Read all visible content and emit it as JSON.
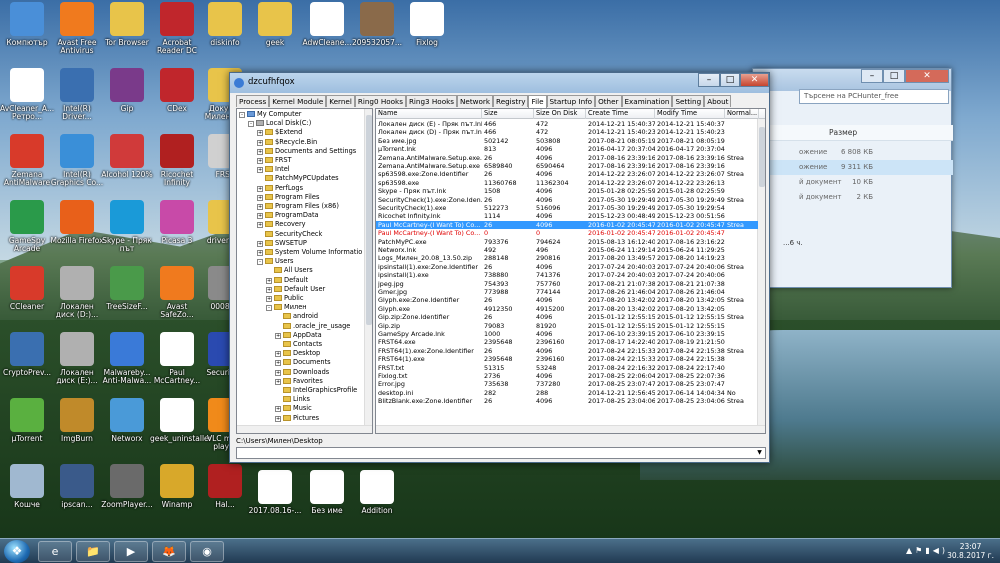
{
  "desktop": {
    "icons": [
      {
        "label": "Компютър",
        "color": "#4a8fd8"
      },
      {
        "label": "Avast Free Antivirus",
        "color": "#f07a1e"
      },
      {
        "label": "Tor Browser",
        "color": "#e8c44a"
      },
      {
        "label": "Acrobat Reader DC",
        "color": "#c0262c"
      },
      {
        "label": "diskinfo",
        "color": "#e8c44a"
      },
      {
        "label": "geek",
        "color": "#e8c44a"
      },
      {
        "label": "AdwCleane...",
        "color": "#ffffff"
      },
      {
        "label": "209532057...",
        "color": "#8a6a4a"
      },
      {
        "label": "Fixlog",
        "color": "#ffffff"
      },
      {
        "label": "AvCleaner_А... Ретро...",
        "color": "#ffffff"
      },
      {
        "label": "Intel(R) Driver...",
        "color": "#3a6fb0"
      },
      {
        "label": "Gip",
        "color": "#7a3a8a"
      },
      {
        "label": "CDex",
        "color": "#c0262c"
      },
      {
        "label": "Докум... Милен К...",
        "color": "#e8c44a"
      },
      {
        "label": "Zemana AntiMalware",
        "color": "#d83a2a"
      },
      {
        "label": "Intel(R) Graphics Co...",
        "color": "#3a8fd8"
      },
      {
        "label": "Alcohol 120%",
        "color": "#d03a3a"
      },
      {
        "label": "Ricochet Infinity",
        "color": "#b02020"
      },
      {
        "label": "FRST",
        "color": "#d0d0d0"
      },
      {
        "label": "GameSpy Arcade",
        "color": "#2a9a4a"
      },
      {
        "label": "Mozilla Firefox",
        "color": "#e8601a"
      },
      {
        "label": "Skype - Пряк път",
        "color": "#1a9ad8"
      },
      {
        "label": "Picasa 3",
        "color": "#c84aa8"
      },
      {
        "label": "driver a...",
        "color": "#e8c44a"
      },
      {
        "label": "CCleaner",
        "color": "#d83a2a"
      },
      {
        "label": "Локален диск (D:)...",
        "color": "#b0b0b0"
      },
      {
        "label": "TreeSizeF...",
        "color": "#4a9a4a"
      },
      {
        "label": "Avast SafeZo...",
        "color": "#f07a1e"
      },
      {
        "label": "0008-...",
        "color": "#8a8a8a"
      },
      {
        "label": "CryptoPrev...",
        "color": "#3a6fb0"
      },
      {
        "label": "Локален диск (E:)...",
        "color": "#b0b0b0"
      },
      {
        "label": "Malwareby... Anti-Malwa...",
        "color": "#3a7ad8"
      },
      {
        "label": "Paul McCartney...",
        "color": "#ffffff"
      },
      {
        "label": "Security...",
        "color": "#2a4ab0"
      },
      {
        "label": "µTorrent",
        "color": "#5ab040"
      },
      {
        "label": "ImgBurn",
        "color": "#c08a2a"
      },
      {
        "label": "Networx",
        "color": "#4a9ad8"
      },
      {
        "label": "geek_uninstaller",
        "color": "#ffffff"
      },
      {
        "label": "VLC me... player",
        "color": "#f08a1a"
      },
      {
        "label": "Кошче",
        "color": "#a0b8d0"
      },
      {
        "label": "ipscan...",
        "color": "#3a5a8a"
      },
      {
        "label": "ZoomPlayer...",
        "color": "#6a6a6a"
      },
      {
        "label": "Winamp",
        "color": "#d8a82a"
      },
      {
        "label": "Hal...",
        "color": "#b02020"
      },
      {
        "label": "2017.08.16-...",
        "color": "#ffffff"
      },
      {
        "label": "Без име",
        "color": "#ffffff"
      },
      {
        "label": "Addition",
        "color": "#ffffff"
      }
    ]
  },
  "explorer": {
    "search_placeholder": "Търсене на PCHunter_free",
    "size_header": "Размер",
    "rows": [
      {
        "name": "ожение",
        "size": "6 808 КБ"
      },
      {
        "name": "ожение",
        "size": "9 311 КБ"
      },
      {
        "name": "й документ",
        "size": "10 КБ"
      },
      {
        "name": "й документ",
        "size": "2 КБ"
      }
    ],
    "footer": "...6 ч."
  },
  "window": {
    "title": "dzcufhfqox",
    "tabs": [
      "Process",
      "Kernel Module",
      "Kernel",
      "Ring0 Hooks",
      "Ring3 Hooks",
      "Network",
      "Registry",
      "File",
      "Startup Info",
      "Other",
      "Examination",
      "Setting",
      "About"
    ],
    "active_tab": "File",
    "tree": [
      {
        "label": "My Computer",
        "level": 0,
        "box": "-"
      },
      {
        "label": "Local Disk(C:)",
        "level": 1,
        "box": "-"
      },
      {
        "label": "$Extend",
        "level": 2,
        "box": "+"
      },
      {
        "label": "$Recycle.Bin",
        "level": 2,
        "box": "+"
      },
      {
        "label": "Documents and Settings",
        "level": 2,
        "box": "+"
      },
      {
        "label": "FRST",
        "level": 2,
        "box": "+"
      },
      {
        "label": "Intel",
        "level": 2,
        "box": "+"
      },
      {
        "label": "PatchMyPCUpdates",
        "level": 2,
        "box": ""
      },
      {
        "label": "PerfLogs",
        "level": 2,
        "box": "+"
      },
      {
        "label": "Program Files",
        "level": 2,
        "box": "+"
      },
      {
        "label": "Program Files (x86)",
        "level": 2,
        "box": "+"
      },
      {
        "label": "ProgramData",
        "level": 2,
        "box": "+"
      },
      {
        "label": "Recovery",
        "level": 2,
        "box": "+"
      },
      {
        "label": "SecurityCheck",
        "level": 2,
        "box": ""
      },
      {
        "label": "SWSETUP",
        "level": 2,
        "box": "+"
      },
      {
        "label": "System Volume Informatio",
        "level": 2,
        "box": "+"
      },
      {
        "label": "Users",
        "level": 2,
        "box": "-"
      },
      {
        "label": "All Users",
        "level": 3,
        "box": ""
      },
      {
        "label": "Default",
        "level": 3,
        "box": "+"
      },
      {
        "label": "Default User",
        "level": 3,
        "box": "+"
      },
      {
        "label": "Public",
        "level": 3,
        "box": "+"
      },
      {
        "label": "Милен",
        "level": 3,
        "box": "-"
      },
      {
        "label": "android",
        "level": 4,
        "box": ""
      },
      {
        "label": ".oracle_jre_usage",
        "level": 4,
        "box": ""
      },
      {
        "label": "AppData",
        "level": 4,
        "box": "+"
      },
      {
        "label": "Contacts",
        "level": 4,
        "box": ""
      },
      {
        "label": "Desktop",
        "level": 4,
        "box": "+"
      },
      {
        "label": "Documents",
        "level": 4,
        "box": "+"
      },
      {
        "label": "Downloads",
        "level": 4,
        "box": "+"
      },
      {
        "label": "Favorites",
        "level": 4,
        "box": "+"
      },
      {
        "label": "IntelGraphicsProfile",
        "level": 4,
        "box": ""
      },
      {
        "label": "Links",
        "level": 4,
        "box": ""
      },
      {
        "label": "Music",
        "level": 4,
        "box": "+"
      },
      {
        "label": "Pictures",
        "level": 4,
        "box": "+"
      }
    ],
    "columns": [
      "Name",
      "Size",
      "Size On Disk",
      "Create Time",
      "Modify Time",
      "Normal..."
    ],
    "files": [
      [
        "Локален диск (E) - Пряк път.lnk",
        "466",
        "472",
        "2014-12-21 15:40:37",
        "2014-12-21 15:40:37",
        ""
      ],
      [
        "Локален диск (D) - Пряк път.lnk",
        "466",
        "472",
        "2014-12-21 15:40:23",
        "2014-12-21 15:40:23",
        ""
      ],
      [
        "Без име.jpg",
        "502142",
        "503808",
        "2017-08-21 08:05:19",
        "2017-08-21 08:05:19",
        ""
      ],
      [
        "µTorrent.lnk",
        "813",
        "4096",
        "2016-04-17 20:37:04",
        "2016-04-17 20:37:04",
        ""
      ],
      [
        "Zemana.AntiMalware.Setup.exe...",
        "26",
        "4096",
        "2017-08-16 23:39:16",
        "2017-08-16 23:39:16",
        "Strea"
      ],
      [
        "Zemana.AntiMalware.Setup.exe",
        "6589840",
        "6590464",
        "2017-08-16 23:39:16",
        "2017-08-16 23:39:16",
        ""
      ],
      [
        "sp63598.exe:Zone.Identifier",
        "26",
        "4096",
        "2014-12-22 23:26:07",
        "2014-12-22 23:26:07",
        "Strea"
      ],
      [
        "sp63598.exe",
        "11360768",
        "11362304",
        "2014-12-22 23:26:07",
        "2014-12-22 23:26:13",
        ""
      ],
      [
        "Skype - Пряк път.lnk",
        "1508",
        "4096",
        "2015-01-28 02:25:59",
        "2015-01-28 02:25:59",
        ""
      ],
      [
        "SecurityCheck(1).exe:Zone.Iden...",
        "26",
        "4096",
        "2017-05-30 19:29:49",
        "2017-05-30 19:29:49",
        "Strea"
      ],
      [
        "SecurityCheck(1).exe",
        "512273",
        "516096",
        "2017-05-30 19:29:49",
        "2017-05-30 19:29:54",
        ""
      ],
      [
        "Ricochet Infinity.lnk",
        "1114",
        "4096",
        "2015-12-23 00:48:49",
        "2015-12-23 00:51:56",
        ""
      ],
      [
        "Paul McCartney-(I Want To) Co...",
        "26",
        "4096",
        "2016-01-02 20:45:47",
        "2016-01-02 20:45:47",
        "Strea"
      ],
      [
        "Paul McCartney-(I Want To) Co...",
        "0",
        "0",
        "2016-01-02 20:45:47",
        "2016-01-02 20:45:47",
        ""
      ],
      [
        "PatchMyPC.exe",
        "793376",
        "794624",
        "2015-08-13 16:12:40",
        "2017-08-16 23:16:22",
        ""
      ],
      [
        "Networx.lnk",
        "492",
        "496",
        "2015-06-24 11:29:14",
        "2015-06-24 11:29:25",
        ""
      ],
      [
        "Logs_Милен_20.08_13.50.zip",
        "288148",
        "290816",
        "2017-08-20 13:49:57",
        "2017-08-20 14:19:23",
        ""
      ],
      [
        "ipsinstall(1).exe:Zone.Identifier",
        "26",
        "4096",
        "2017-07-24 20:40:03",
        "2017-07-24 20:40:06",
        "Strea"
      ],
      [
        "ipsinstall(1).exe",
        "738880",
        "741376",
        "2017-07-24 20:40:03",
        "2017-07-24 20:40:06",
        ""
      ],
      [
        "jpeg.jpg",
        "754393",
        "757760",
        "2017-08-21 21:07:38",
        "2017-08-21 21:07:38",
        ""
      ],
      [
        "Gmer.jpg",
        "773988",
        "774144",
        "2017-08-26 21:46:04",
        "2017-08-26 21:46:04",
        ""
      ],
      [
        "Glyph.exe:Zone.Identifier",
        "26",
        "4096",
        "2017-08-20 13:42:02",
        "2017-08-20 13:42:05",
        "Strea"
      ],
      [
        "Glyph.exe",
        "4912350",
        "4915200",
        "2017-08-20 13:42:02",
        "2017-08-20 13:42:05",
        ""
      ],
      [
        "Gip.zip:Zone.Identifier",
        "26",
        "4096",
        "2015-01-12 12:55:15",
        "2015-01-12 12:55:15",
        "Strea"
      ],
      [
        "Gip.zip",
        "79083",
        "81920",
        "2015-01-12 12:55:15",
        "2015-01-12 12:55:15",
        ""
      ],
      [
        "GameSpy Arcade.lnk",
        "1000",
        "4096",
        "2017-06-10 23:39:15",
        "2017-06-10 23:39:15",
        ""
      ],
      [
        "FRST64.exe",
        "2395648",
        "2396160",
        "2017-08-17 14:22:40",
        "2017-08-19 21:21:50",
        ""
      ],
      [
        "FRST64(1).exe:Zone.Identifier",
        "26",
        "4096",
        "2017-08-24 22:15:33",
        "2017-08-24 22:15:38",
        "Strea"
      ],
      [
        "FRST64(1).exe",
        "2395648",
        "2396160",
        "2017-08-24 22:15:33",
        "2017-08-24 22:15:38",
        ""
      ],
      [
        "FRST.txt",
        "51315",
        "53248",
        "2017-08-24 22:16:32",
        "2017-08-24 22:17:40",
        ""
      ],
      [
        "Fixlog.txt",
        "2736",
        "4096",
        "2017-08-25 22:06:04",
        "2017-08-25 22:07:36",
        ""
      ],
      [
        "Error.jpg",
        "735638",
        "737280",
        "2017-08-25 23:07:47",
        "2017-08-25 23:07:47",
        ""
      ],
      [
        "desktop.ini",
        "282",
        "288",
        "2014-12-21 12:56:45",
        "2017-06-14 14:04:34",
        "No"
      ],
      [
        "BlitzBlank.exe:Zone.Identifier",
        "26",
        "4096",
        "2017-08-25 23:04:06",
        "2017-08-25 23:04:06",
        "Strea"
      ]
    ],
    "selected_row": 12,
    "red_row": 13,
    "status_path": "C:\\Users\\Милен\\Desktop",
    "path_value": ""
  },
  "taskbar": {
    "start_glyph": "❖",
    "apps": [
      "e",
      "📁",
      "▶",
      "🦊",
      "◉"
    ],
    "time": "23:07",
    "date": "30.8.2017 г."
  }
}
